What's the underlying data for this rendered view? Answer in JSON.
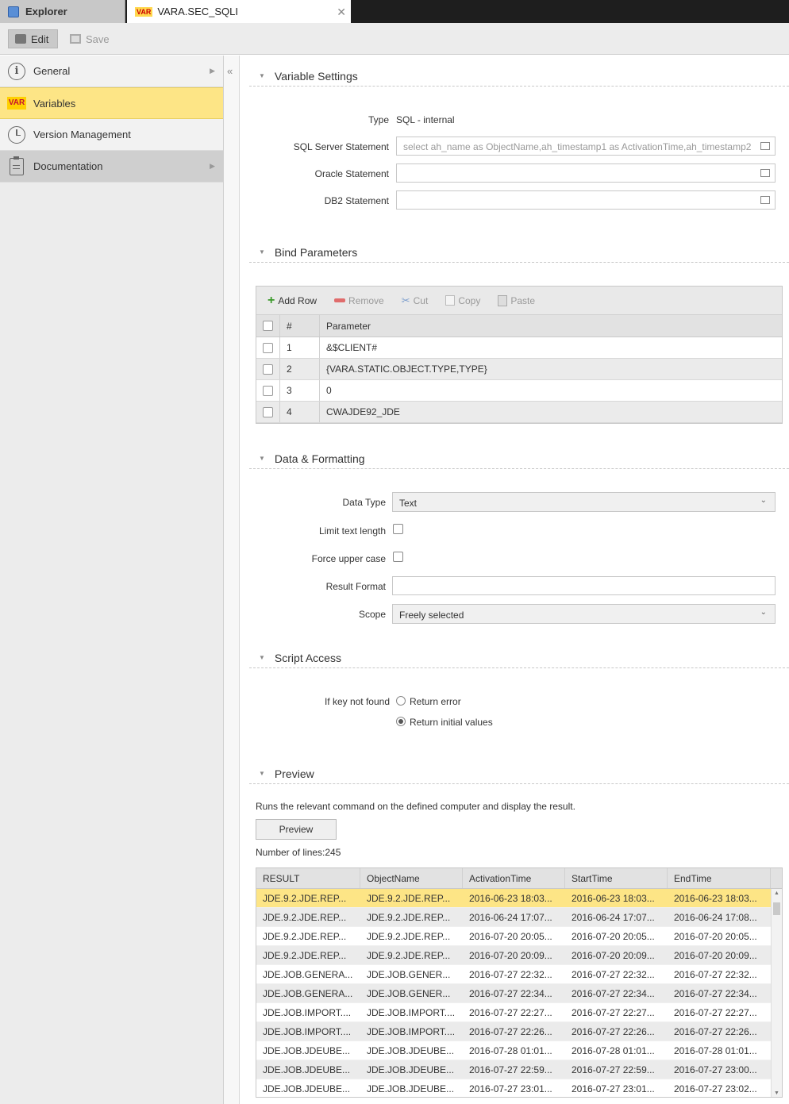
{
  "tabs": {
    "explorer": "Explorer",
    "active": "VARA.SEC_SQLI",
    "active_badge": "VAR"
  },
  "toolbar": {
    "edit": "Edit",
    "save": "Save"
  },
  "sidebar": {
    "items": [
      {
        "label": "General"
      },
      {
        "label": "Variables",
        "badge": "VAR"
      },
      {
        "label": "Version Management"
      },
      {
        "label": "Documentation"
      }
    ]
  },
  "variable_settings": {
    "title": "Variable Settings",
    "type_label": "Type",
    "type_value": "SQL - internal",
    "sql_server_label": "SQL Server Statement",
    "sql_server_value": "select ah_name as ObjectName,ah_timestamp1 as ActivationTime,ah_timestamp2",
    "oracle_label": "Oracle Statement",
    "oracle_value": "",
    "db2_label": "DB2 Statement",
    "db2_value": ""
  },
  "bind_parameters": {
    "title": "Bind Parameters",
    "toolbar": {
      "add": "Add Row",
      "remove": "Remove",
      "cut": "Cut",
      "copy": "Copy",
      "paste": "Paste"
    },
    "columns": {
      "num": "#",
      "param": "Parameter"
    },
    "rows": [
      {
        "num": "1",
        "param": "&$CLIENT#"
      },
      {
        "num": "2",
        "param": "{VARA.STATIC.OBJECT.TYPE,TYPE}"
      },
      {
        "num": "3",
        "param": "0"
      },
      {
        "num": "4",
        "param": "CWAJDE92_JDE"
      }
    ]
  },
  "data_formatting": {
    "title": "Data & Formatting",
    "data_type_label": "Data Type",
    "data_type_value": "Text",
    "limit_label": "Limit text length",
    "upper_label": "Force upper case",
    "result_format_label": "Result Format",
    "result_format_value": "",
    "scope_label": "Scope",
    "scope_value": "Freely selected"
  },
  "script_access": {
    "title": "Script Access",
    "key_label": "If key not found",
    "opt1": "Return error",
    "opt2": "Return initial values"
  },
  "preview": {
    "title": "Preview",
    "description": "Runs the relevant command on the defined computer and display the result.",
    "button": "Preview",
    "lines": "Number of lines:245",
    "columns": [
      "RESULT",
      "ObjectName",
      "ActivationTime",
      "StartTime",
      "EndTime"
    ],
    "rows": [
      [
        "JDE.9.2.JDE.REP...",
        "JDE.9.2.JDE.REP...",
        "2016-06-23 18:03...",
        "2016-06-23 18:03...",
        "2016-06-23 18:03..."
      ],
      [
        "JDE.9.2.JDE.REP...",
        "JDE.9.2.JDE.REP...",
        "2016-06-24 17:07...",
        "2016-06-24 17:07...",
        "2016-06-24 17:08..."
      ],
      [
        "JDE.9.2.JDE.REP...",
        "JDE.9.2.JDE.REP...",
        "2016-07-20 20:05...",
        "2016-07-20 20:05...",
        "2016-07-20 20:05..."
      ],
      [
        "JDE.9.2.JDE.REP...",
        "JDE.9.2.JDE.REP...",
        "2016-07-20 20:09...",
        "2016-07-20 20:09...",
        "2016-07-20 20:09..."
      ],
      [
        "JDE.JOB.GENERA...",
        "JDE.JOB.GENER...",
        "2016-07-27 22:32...",
        "2016-07-27 22:32...",
        "2016-07-27 22:32..."
      ],
      [
        "JDE.JOB.GENERA...",
        "JDE.JOB.GENER...",
        "2016-07-27 22:34...",
        "2016-07-27 22:34...",
        "2016-07-27 22:34..."
      ],
      [
        "JDE.JOB.IMPORT....",
        "JDE.JOB.IMPORT....",
        "2016-07-27 22:27...",
        "2016-07-27 22:27...",
        "2016-07-27 22:27..."
      ],
      [
        "JDE.JOB.IMPORT....",
        "JDE.JOB.IMPORT....",
        "2016-07-27 22:26...",
        "2016-07-27 22:26...",
        "2016-07-27 22:26..."
      ],
      [
        "JDE.JOB.JDEUBE...",
        "JDE.JOB.JDEUBE...",
        "2016-07-28 01:01...",
        "2016-07-28 01:01...",
        "2016-07-28 01:01..."
      ],
      [
        "JDE.JOB.JDEUBE...",
        "JDE.JOB.JDEUBE...",
        "2016-07-27 22:59...",
        "2016-07-27 22:59...",
        "2016-07-27 23:00..."
      ],
      [
        "JDE.JOB.JDEUBE...",
        "JDE.JOB.JDEUBE...",
        "2016-07-27 23:01...",
        "2016-07-27 23:01...",
        "2016-07-27 23:02..."
      ]
    ]
  }
}
